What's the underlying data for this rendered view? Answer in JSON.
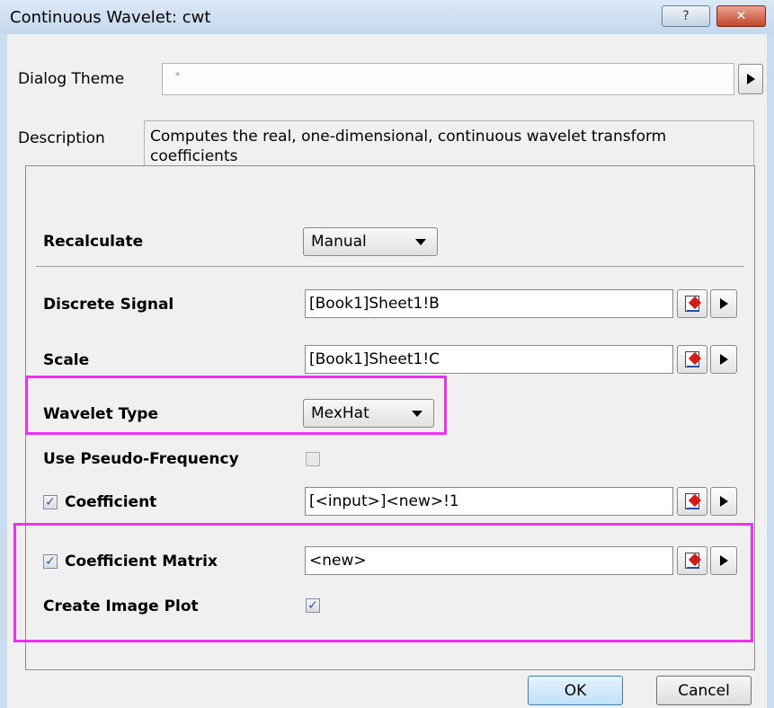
{
  "window": {
    "title": "Continuous Wavelet: cwt",
    "help_label": "?",
    "close_label": "✕"
  },
  "theme": {
    "label": "Dialog Theme",
    "value": "*"
  },
  "description": {
    "label": "Description",
    "text": "Computes the real, one-dimensional, continuous wavelet transform coefficients"
  },
  "form": {
    "recalculate": {
      "label": "Recalculate",
      "value": "Manual"
    },
    "discrete_signal": {
      "label": "Discrete Signal",
      "value": "[Book1]Sheet1!B"
    },
    "scale": {
      "label": "Scale",
      "value": "[Book1]Sheet1!C"
    },
    "wavelet_type": {
      "label": "Wavelet Type",
      "value": "MexHat"
    },
    "pseudo_frequency": {
      "label": "Use Pseudo-Frequency",
      "checked": false
    },
    "coefficient": {
      "label": "Coefficient",
      "checked": true,
      "value": "[<input>]<new>!1"
    },
    "coefficient_matrix": {
      "label": "Coefficient Matrix",
      "checked": true,
      "value": "<new>"
    },
    "create_image_plot": {
      "label": "Create Image Plot",
      "checked": true
    }
  },
  "buttons": {
    "ok": "OK",
    "cancel": "Cancel"
  },
  "colors": {
    "highlight": "#ee31ee",
    "checkmark": "#2a5a9e"
  }
}
